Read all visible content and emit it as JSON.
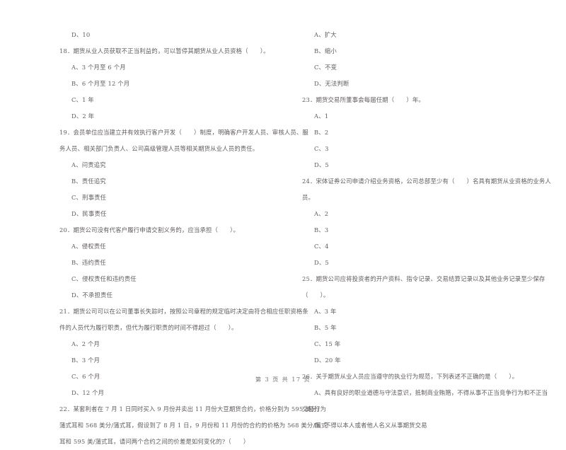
{
  "document": {
    "background_color": "#ffffff",
    "text_color": "#555052",
    "footer": "第 3 页  共 17 页"
  },
  "left_column": {
    "lines": [
      {
        "kind": "option",
        "text": "D、10"
      },
      {
        "kind": "question",
        "text": "18．期货从业人员获取不正当利益的，可以暂停其期货从业人员资格（　　）。"
      },
      {
        "kind": "option",
        "text": "A、3 个月至 6 个月"
      },
      {
        "kind": "option",
        "text": "B、6 个月至 12 个月"
      },
      {
        "kind": "option",
        "text": "C、1 年"
      },
      {
        "kind": "option",
        "text": "D、2 年"
      },
      {
        "kind": "question",
        "text": "19．会员单位应当建立并有效执行客户开发（　　）制度，明确客户开发人员、审核人员、服"
      },
      {
        "kind": "q-cont",
        "text": "务人员、相关部门负责人、公司高级管理人员等相关期货从业人员的责任。"
      },
      {
        "kind": "option",
        "text": "A、问责追究"
      },
      {
        "kind": "option",
        "text": "B、责任追究"
      },
      {
        "kind": "option",
        "text": "C、刑事责任"
      },
      {
        "kind": "option",
        "text": "D、民事责任"
      },
      {
        "kind": "question",
        "text": "20．期货公司没有代客户履行申请交割义务的，应当承担（　　）。"
      },
      {
        "kind": "option",
        "text": "A、侵权责任"
      },
      {
        "kind": "option",
        "text": "B、违约责任"
      },
      {
        "kind": "option",
        "text": "C、侵权责任和违约责任"
      },
      {
        "kind": "option",
        "text": "D、不承担责任"
      },
      {
        "kind": "question",
        "text": "21．期货公司可以在公司董事长失踪时，按照公司章程的规定临时决定由符合相应任职资格条"
      },
      {
        "kind": "q-cont",
        "text": "件的人员代为履行职责，但代为履行职责的时间不得超过（　　）。"
      },
      {
        "kind": "option",
        "text": "A、2 个月"
      },
      {
        "kind": "option",
        "text": "B、3 个月"
      },
      {
        "kind": "option",
        "text": "C、6 个月"
      },
      {
        "kind": "option",
        "text": "D、12 个月"
      },
      {
        "kind": "question",
        "text": "22．某套利者在 7 月 1 日同时买入 9 月份并卖出 11 月份大豆期货合约，价格分别为 595 美分/"
      },
      {
        "kind": "q-cont",
        "text": "蒲式耳和 568 美分/蒲式耳，假设到了 8 月 1 日，9 月份和 11 月份的合约的价格为 568 美分/蒲式"
      },
      {
        "kind": "q-cont",
        "text": "耳和 595 美/蒲式耳，请问两个合约之间的价差是如何变化的?（　　）"
      }
    ]
  },
  "right_column": {
    "lines": [
      {
        "kind": "option",
        "text": "A、扩大"
      },
      {
        "kind": "option",
        "text": "B、缩小"
      },
      {
        "kind": "option",
        "text": "C、不变"
      },
      {
        "kind": "option",
        "text": "D、无法判断"
      },
      {
        "kind": "question",
        "text": "23．期货交易所董事会每届任期（　　）年。"
      },
      {
        "kind": "option",
        "text": "A、1"
      },
      {
        "kind": "option",
        "text": "B、2"
      },
      {
        "kind": "option",
        "text": "C、3"
      },
      {
        "kind": "option",
        "text": "D、5"
      },
      {
        "kind": "question",
        "text": "24．宋体证券公司申请介绍业务资格，公司总部至少有（　　）名具有期货从业资格的业务人"
      },
      {
        "kind": "q-cont",
        "text": "员。"
      },
      {
        "kind": "option",
        "text": "A、2"
      },
      {
        "kind": "option",
        "text": "B、3"
      },
      {
        "kind": "option",
        "text": "C、4"
      },
      {
        "kind": "option",
        "text": "D、5"
      },
      {
        "kind": "question",
        "text": "25．期货公司应将投资者的开户资料、指令记录、交易结算记录以及其他业务记录至少保存"
      },
      {
        "kind": "q-cont",
        "text": "（　　）。"
      },
      {
        "kind": "option",
        "text": "A、3 年"
      },
      {
        "kind": "option",
        "text": "B、5 年"
      },
      {
        "kind": "option",
        "text": "C、15 年"
      },
      {
        "kind": "option",
        "text": "D、20 年"
      },
      {
        "kind": "question",
        "text": "26．关于期货从业人员应当遵守的执业行为规范，下列表述不正确的是（　　）。"
      },
      {
        "kind": "option",
        "text": "A、具有良好的职业道德与守法意识，抵制商业贿赂，不得从事不正当竞争行为和不正当"
      },
      {
        "kind": "opt-cont",
        "text": "交易行为"
      },
      {
        "kind": "option",
        "text": "B、不得以本人或者他人名义从事期货交易"
      }
    ]
  }
}
